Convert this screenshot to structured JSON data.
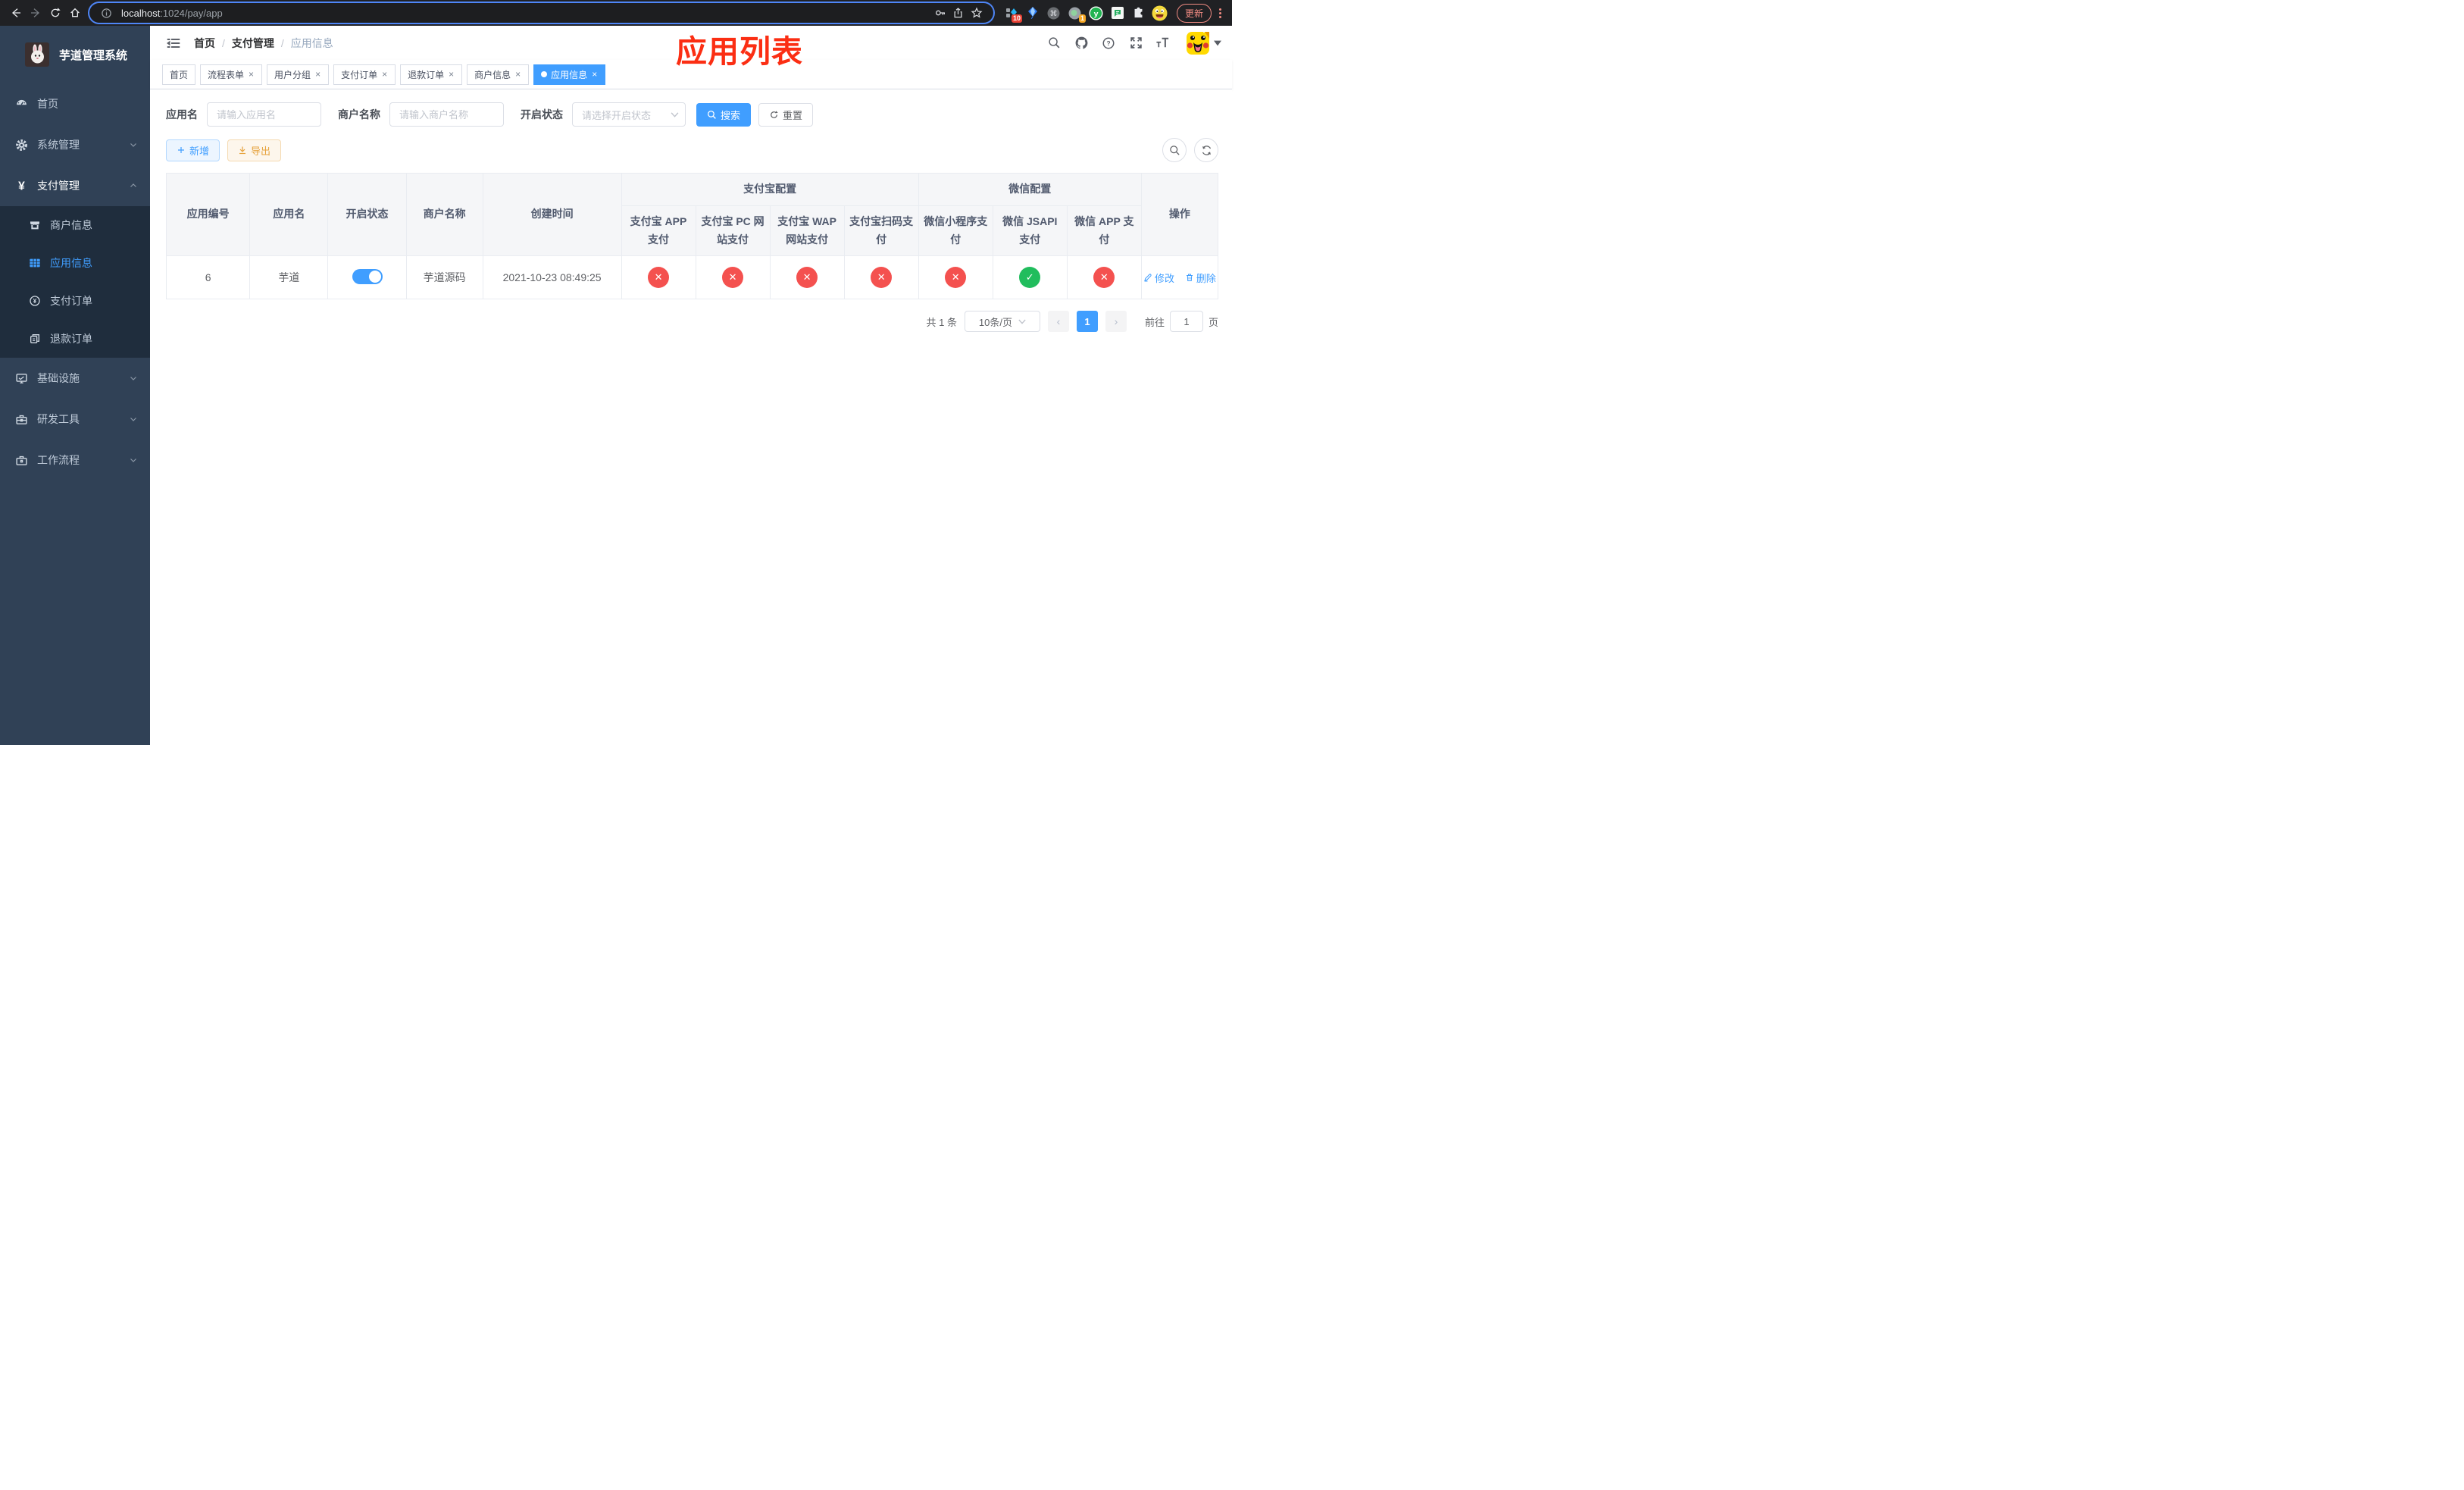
{
  "browser": {
    "url_host": "localhost",
    "url_rest": ":1024/pay/app",
    "update_label": "更新",
    "ext_badge_blocks": "10",
    "ext_badge_record": "1"
  },
  "sidebar": {
    "title": "芋道管理系统",
    "menu": {
      "home": "首页",
      "system": "系统管理",
      "pay": "支付管理",
      "infra": "基础设施",
      "dev": "研发工具",
      "flow": "工作流程"
    },
    "submenu": {
      "merchant": "商户信息",
      "app": "应用信息",
      "pay_order": "支付订单",
      "refund": "退款订单"
    }
  },
  "header": {
    "breadcrumb": [
      "首页",
      "支付管理",
      "应用信息"
    ],
    "annotation": "应用列表"
  },
  "tabs": [
    {
      "label": "首页"
    },
    {
      "label": "流程表单"
    },
    {
      "label": "用户分组"
    },
    {
      "label": "支付订单"
    },
    {
      "label": "退款订单"
    },
    {
      "label": "商户信息"
    },
    {
      "label": "应用信息"
    }
  ],
  "filters": {
    "app_name": {
      "label": "应用名",
      "placeholder": "请输入应用名"
    },
    "merchant": {
      "label": "商户名称",
      "placeholder": "请输入商户名称"
    },
    "status": {
      "label": "开启状态",
      "placeholder": "请选择开启状态"
    },
    "search_label": "搜索",
    "reset_label": "重置"
  },
  "toolbar": {
    "add_label": "新增",
    "export_label": "导出"
  },
  "table": {
    "columns": [
      "应用编号",
      "应用名",
      "开启状态",
      "商户名称",
      "创建时间"
    ],
    "groups": {
      "alipay": "支付宝配置",
      "wechat": "微信配置"
    },
    "sub_columns": [
      "支付宝 APP 支付",
      "支付宝 PC 网站支付",
      "支付宝 WAP 网站支付",
      "支付宝扫码支付",
      "微信小程序支付",
      "微信 JSAPI 支付",
      "微信 APP 支付"
    ],
    "action_column": "操作",
    "rows": [
      {
        "id": "6",
        "name": "芋道",
        "enabled": true,
        "merchant": "芋道源码",
        "created_at": "2021-10-23 08:49:25",
        "statuses": [
          {
            "symbol": "✕",
            "ok": false
          },
          {
            "symbol": "✕",
            "ok": false
          },
          {
            "symbol": "✕",
            "ok": false
          },
          {
            "symbol": "✕",
            "ok": false
          },
          {
            "symbol": "✕",
            "ok": false
          },
          {
            "symbol": "✓",
            "ok": true
          },
          {
            "symbol": "✕",
            "ok": false
          }
        ],
        "edit_label": "修改",
        "delete_label": "删除"
      }
    ]
  },
  "pagination": {
    "total": "共 1 条",
    "page_size": "10条/页",
    "page": "1",
    "goto_label": "前往",
    "goto_value": "1",
    "page_unit": "页"
  },
  "glyphs": {
    "close": "×",
    "caret": "∨",
    "prev": "‹",
    "next": "›",
    "check_q": "?",
    "yen": "¥",
    "cmd": "⌘",
    "y_letter": "y",
    "info_i": "i"
  },
  "colors": {
    "accent": "#409eff",
    "danger": "#f4514f",
    "success": "#21bd5d",
    "annotation": "#fb2e13",
    "warning": "#e6a23c"
  }
}
